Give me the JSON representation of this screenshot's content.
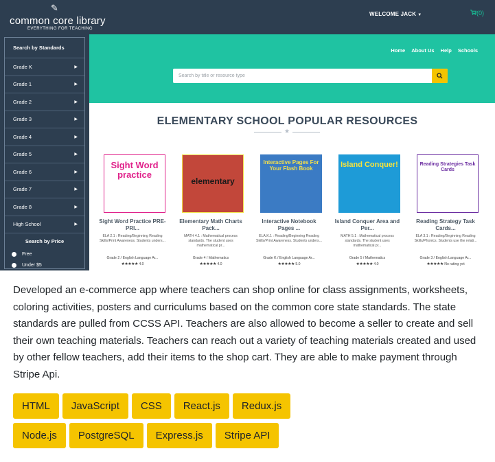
{
  "app": {
    "logo_title": "common core library",
    "logo_subtitle": "EVERYTHING FOR TEACHING",
    "welcome": "WELCOME JACK",
    "cart_count": "0",
    "accent_color": "#1fc3a2",
    "nav_color": "#2d3e50",
    "button_color": "#f5c400"
  },
  "nav": {
    "links": [
      "Home",
      "About Us",
      "Help",
      "Schools"
    ]
  },
  "search": {
    "placeholder": "Search by title or resource type"
  },
  "sidebar": {
    "standards_header": "Search by Standards",
    "grades": [
      "Grade K",
      "Grade 1",
      "Grade 2",
      "Grade 3",
      "Grade 4",
      "Grade 5",
      "Grade 6",
      "Grade 7",
      "Grade 8",
      "High School"
    ],
    "price_header": "Search by Price",
    "price_options": [
      "Free",
      "Under $5"
    ]
  },
  "section": {
    "title": "ELEMENTARY SCHOOL POPULAR RESOURCES"
  },
  "products": [
    {
      "cover_text": "Sight Word practice",
      "title": "Sight Word Practice PRE-PRI...",
      "desc": "ELA 2.1 : Reading/Beginning Reading Skills/Print Awareness. Students unders...",
      "grade": "Grade 2 / English Language Ar...",
      "stars": "★★★★★",
      "rating": "4.0"
    },
    {
      "cover_text": "elementary",
      "title": "Elementary Math Charts Pack...",
      "desc": "MATH 4.1 : Mathematical process standards. The student uses mathematical pr...",
      "grade": "Grade 4 / Mathematics",
      "stars": "★★★★★",
      "rating": "4.0"
    },
    {
      "cover_text": "Interactive Pages For Your Flash Book",
      "title": "Interactive Notebook Pages ...",
      "desc": "ELA.K.1 : Reading/Beginning Reading Skills/Print Awareness. Students unders...",
      "grade": "Grade K / English Language Ar...",
      "stars": "★★★★★",
      "rating": "5.0"
    },
    {
      "cover_text": "Island Conquer!",
      "title": "Island Conquer Area and Per...",
      "desc": "MATH 5.1 : Mathematical process standards. The student uses mathematical pr...",
      "grade": "Grade 5 / Mathematics",
      "stars": "★★★★★",
      "rating": "4.0"
    },
    {
      "cover_text": "Reading Strategies Task Cards",
      "title": "Reading Strategy Task Cards...",
      "desc": "ELA 3.1 : Reading/Beginning Reading Skills/Phonics. Students use the relati...",
      "grade": "Grade 3 / English Language Ar...",
      "stars": "★★★★★",
      "rating": "No rating yet"
    }
  ],
  "description": "Developed an e-commerce app where teachers can shop online for class assignments, worksheets, coloring activities, posters and curriculums based on the common core state standards. The state standards are pulled from CCSS API. Teachers are also allowed to become a seller to create and sell their own teaching materials. Teachers can reach out a variety of teaching materials created and used by other fellow teachers, add their items to the shop cart. They are able to make payment through Stripe Api.",
  "tags_row1": [
    "HTML",
    "JavaScript",
    "CSS",
    "React.js",
    "Redux.js"
  ],
  "tags_row2": [
    "Node.js",
    "PostgreSQL",
    "Express.js",
    "Stripe API"
  ]
}
